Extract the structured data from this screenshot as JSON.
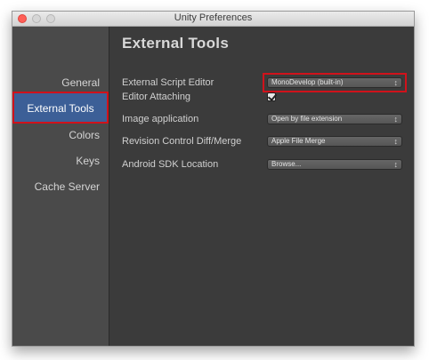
{
  "window": {
    "title": "Unity Preferences"
  },
  "sidebar": {
    "items": [
      {
        "label": "General"
      },
      {
        "label": "External Tools",
        "active": true
      },
      {
        "label": "Colors"
      },
      {
        "label": "Keys"
      },
      {
        "label": "Cache Server"
      }
    ]
  },
  "panel": {
    "heading": "External Tools",
    "rows": [
      {
        "label": "External Script Editor",
        "control": "dropdown",
        "value": "MonoDevelop (built-in)"
      },
      {
        "label": "Editor Attaching",
        "control": "checkbox",
        "checked": true
      },
      {
        "label": "Image application",
        "control": "dropdown",
        "value": "Open by file extension"
      },
      {
        "label": "Revision Control Diff/Merge",
        "control": "dropdown",
        "value": "Apple File Merge"
      },
      {
        "label": "Android SDK Location",
        "control": "dropdown",
        "value": "Browse..."
      }
    ]
  },
  "colors": {
    "selection": "#3c5f97",
    "annotation_highlight": "#d0121b",
    "background": "#3b3b3b"
  },
  "icons": {
    "dropdown_arrow": "updown-arrows-icon",
    "check": "checkmark-icon"
  }
}
